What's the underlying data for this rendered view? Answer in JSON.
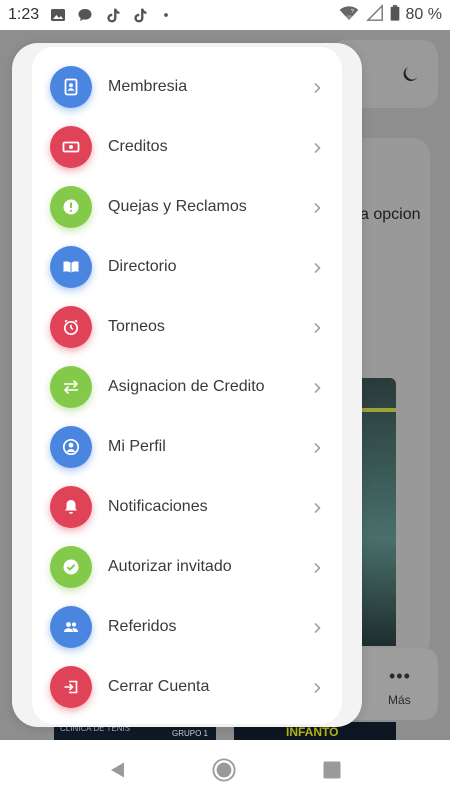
{
  "status_bar": {
    "time": "1:23",
    "battery": "80 %",
    "icons": [
      "image-icon",
      "chat-bubble-icon",
      "tiktok-icon",
      "tiktok-icon",
      "dot-icon",
      "wifi-icon",
      "signal-icon",
      "battery-icon"
    ]
  },
  "background": {
    "opcion_text": "a opcion",
    "mas_label": "Más",
    "mas_dots": "•••",
    "banner_1_text": "CLINICA DE TENIS",
    "banner_1_sub": "GRUPO 1",
    "banner_2_text": "INFANTO"
  },
  "menu": {
    "items": [
      {
        "label": "Membresia",
        "icon": "id-card-icon",
        "color": "#4a86e0"
      },
      {
        "label": "Creditos",
        "icon": "money-icon",
        "color": "#e04357"
      },
      {
        "label": "Quejas y Reclamos",
        "icon": "exclamation-icon",
        "color": "#83c94a"
      },
      {
        "label": "Directorio",
        "icon": "book-icon",
        "color": "#4a86e0"
      },
      {
        "label": "Torneos",
        "icon": "stopwatch-icon",
        "color": "#e04357"
      },
      {
        "label": "Asignacion de Credito",
        "icon": "transfer-arrows-icon",
        "color": "#83c94a"
      },
      {
        "label": "Mi Perfil",
        "icon": "user-circle-icon",
        "color": "#4a86e0"
      },
      {
        "label": "Notificaciones",
        "icon": "bell-icon",
        "color": "#e04357"
      },
      {
        "label": "Autorizar invitado",
        "icon": "check-circle-icon",
        "color": "#83c94a"
      },
      {
        "label": "Referidos",
        "icon": "users-icon",
        "color": "#4a86e0"
      },
      {
        "label": "Cerrar Cuenta",
        "icon": "sign-out-icon",
        "color": "#e04357"
      }
    ]
  },
  "nav_bar": {
    "icons": [
      "back-icon",
      "home-icon",
      "recents-icon"
    ]
  },
  "colors": {
    "accent_blue": "#4a86e0",
    "accent_red": "#e04357",
    "accent_green": "#83c94a",
    "scrim": "#8e8e8e"
  }
}
